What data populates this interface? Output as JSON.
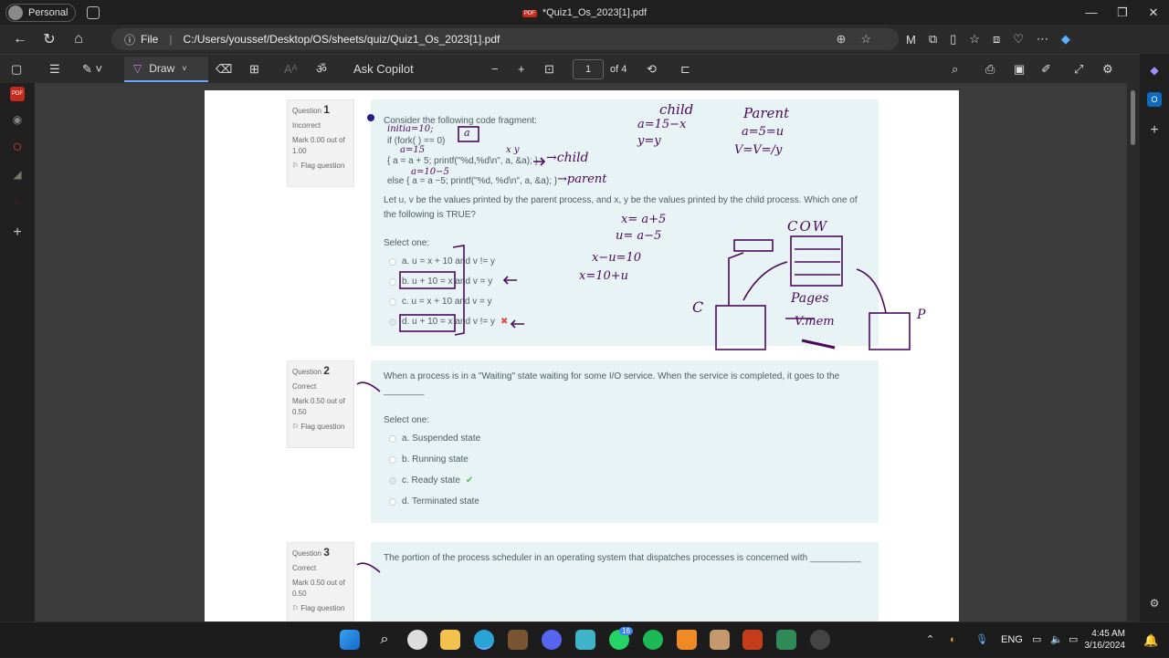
{
  "window": {
    "profile_label": "Personal",
    "title": "*Quiz1_Os_2023[1].pdf",
    "pdf_badge": "PDF"
  },
  "addressbar": {
    "file_label": "File",
    "url": "C:/Users/youssef/Desktop/OS/sheets/quiz/Quiz1_Os_2023[1].pdf"
  },
  "pdf_toolbar": {
    "draw_label": "Draw",
    "ask_copilot_label": "Ask Copilot",
    "page_current": "1",
    "page_total": "of 4",
    "read_aloud_glyph": "ॐ"
  },
  "questions": [
    {
      "label": "Question",
      "number": "1",
      "status": "Incorrect",
      "mark": "Mark 0.00 out of 1.00",
      "flag": "Flag question",
      "text_intro": "Consider the following code fragment:",
      "code_line1": "if (fork( ) == 0)",
      "code_line2": "{ a = a + 5; printf(\"%d,%d\\n\", a, &a); }",
      "code_line3": "else { a = a −5; printf(\"%d, %d\\n\", a, &a); }",
      "text_body": "Let u, v be the values printed by the parent process, and x, y be the values printed by the child process. Which one of the following is TRUE?",
      "select_label": "Select one:",
      "options": [
        "a. u = x + 10 and v != y",
        "b. u + 10 = x and v = y",
        "c. u = x + 10 and v = y",
        "d. u + 10 = x and v != y"
      ],
      "wrong_mark": "✖"
    },
    {
      "label": "Question",
      "number": "2",
      "status": "Correct",
      "mark": "Mark 0.50 out of 0.50",
      "flag": "Flag question",
      "text_body": "When a process is in a \"Waiting\" state waiting for some I/O service. When the service is completed, it goes to the ________",
      "select_label": "Select one:",
      "options": [
        "a. Suspended state",
        "b. Running state",
        "c. Ready state",
        "d. Terminated state"
      ],
      "correct_mark": "✔"
    },
    {
      "label": "Question",
      "number": "3",
      "status": "Correct",
      "mark": "Mark 0.50 out of 0.50",
      "flag": "Flag question",
      "text_body": "The portion of the process scheduler in an operating system that dispatches processes is concerned with __________"
    }
  ],
  "handwriting": {
    "child_title": "child",
    "child_l1": "a=15−x",
    "child_l2": "y=y",
    "parent_title": "Parent",
    "parent_l1": "a=5=u",
    "parent_l2": "V=V=/y",
    "arrow_child": "→child",
    "arrow_parent": "→parent",
    "eq1": "x= a+5",
    "eq2": "u= a−5",
    "eq3": "x−u=10",
    "eq4": "x=10+u",
    "cow": "COW",
    "pages": "Pages",
    "vmem": "V.mem",
    "c_label": "C",
    "p_label": "P",
    "note_a": "a",
    "note_xy": "x  y",
    "note_top": "initia=10;",
    "note_15": "a=15",
    "note_105": "a=10−5"
  },
  "taskbar": {
    "lang": "ENG",
    "time": "4:45 AM",
    "date": "3/16/2024",
    "whatsapp_badge": "16"
  },
  "colors": {
    "accent": "#6fa8ff",
    "ink": "#4a0a5c",
    "answer_bg": "#e7f3f5",
    "wrong": "#d9534f",
    "correct": "#5cb85c"
  }
}
